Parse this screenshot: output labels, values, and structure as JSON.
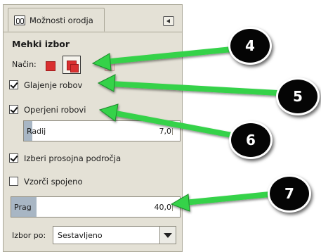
{
  "panel": {
    "tab_label": "Možnosti orodja",
    "section_title": "Mehki izbor",
    "mode_label": "Način:",
    "options": {
      "antialias": {
        "label": "Glajenje robov",
        "checked": true
      },
      "feather": {
        "label": "Operjeni robovi",
        "checked": true
      },
      "select_transparent": {
        "label": "Izberi prosojna področja",
        "checked": true
      },
      "sample_merged": {
        "label": "Vzorči spojeno",
        "checked": false
      }
    },
    "radius": {
      "label": "Radij",
      "value": "7,0"
    },
    "threshold": {
      "label": "Prag",
      "value": "40,0"
    },
    "select_by": {
      "label": "Izbor po:",
      "value": "Sestavljeno"
    }
  },
  "callouts": [
    "4",
    "5",
    "6",
    "7"
  ],
  "colors": {
    "arrow": "#35d24a",
    "bubble": "#050505",
    "selection_red": "#d93030",
    "panel_bg": "#e4e1d6"
  }
}
